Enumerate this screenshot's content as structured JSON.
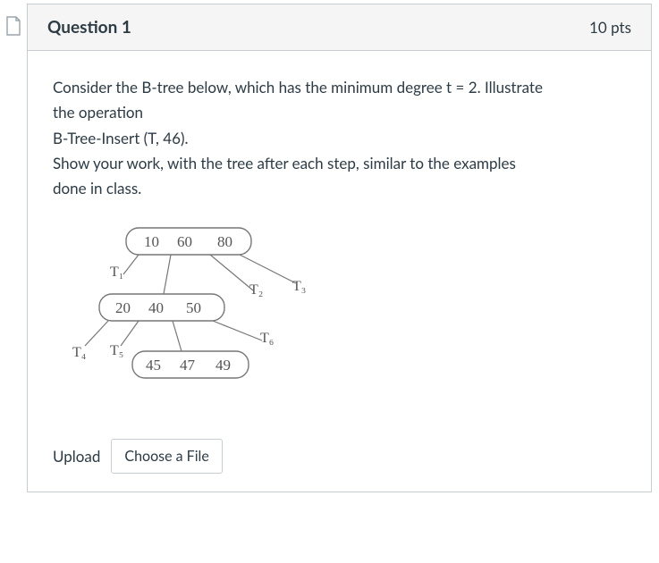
{
  "header": {
    "question_label": "Question 1",
    "points": "10 pts"
  },
  "prompt": {
    "line1": "Consider the B-tree below, which has the minimum degree t = 2. Illustrate",
    "line2": "the operation",
    "line3": "B-Tree-Insert (T, 46).",
    "line4": "Show your work, with the tree after each step, similar to the examples",
    "line5": "done in class."
  },
  "btree": {
    "root": {
      "keys": [
        "10",
        "60",
        "80"
      ]
    },
    "mid": {
      "keys": [
        "20",
        "40",
        "50"
      ]
    },
    "leaf": {
      "keys": [
        "45",
        "47",
        "49"
      ]
    },
    "subtree_labels": {
      "T1": "T₁",
      "T2": "T₂",
      "T3": "T₃",
      "T4": "T₄",
      "T5": "T₅",
      "T6": "T₆"
    }
  },
  "upload": {
    "label": "Upload",
    "button": "Choose a File"
  }
}
